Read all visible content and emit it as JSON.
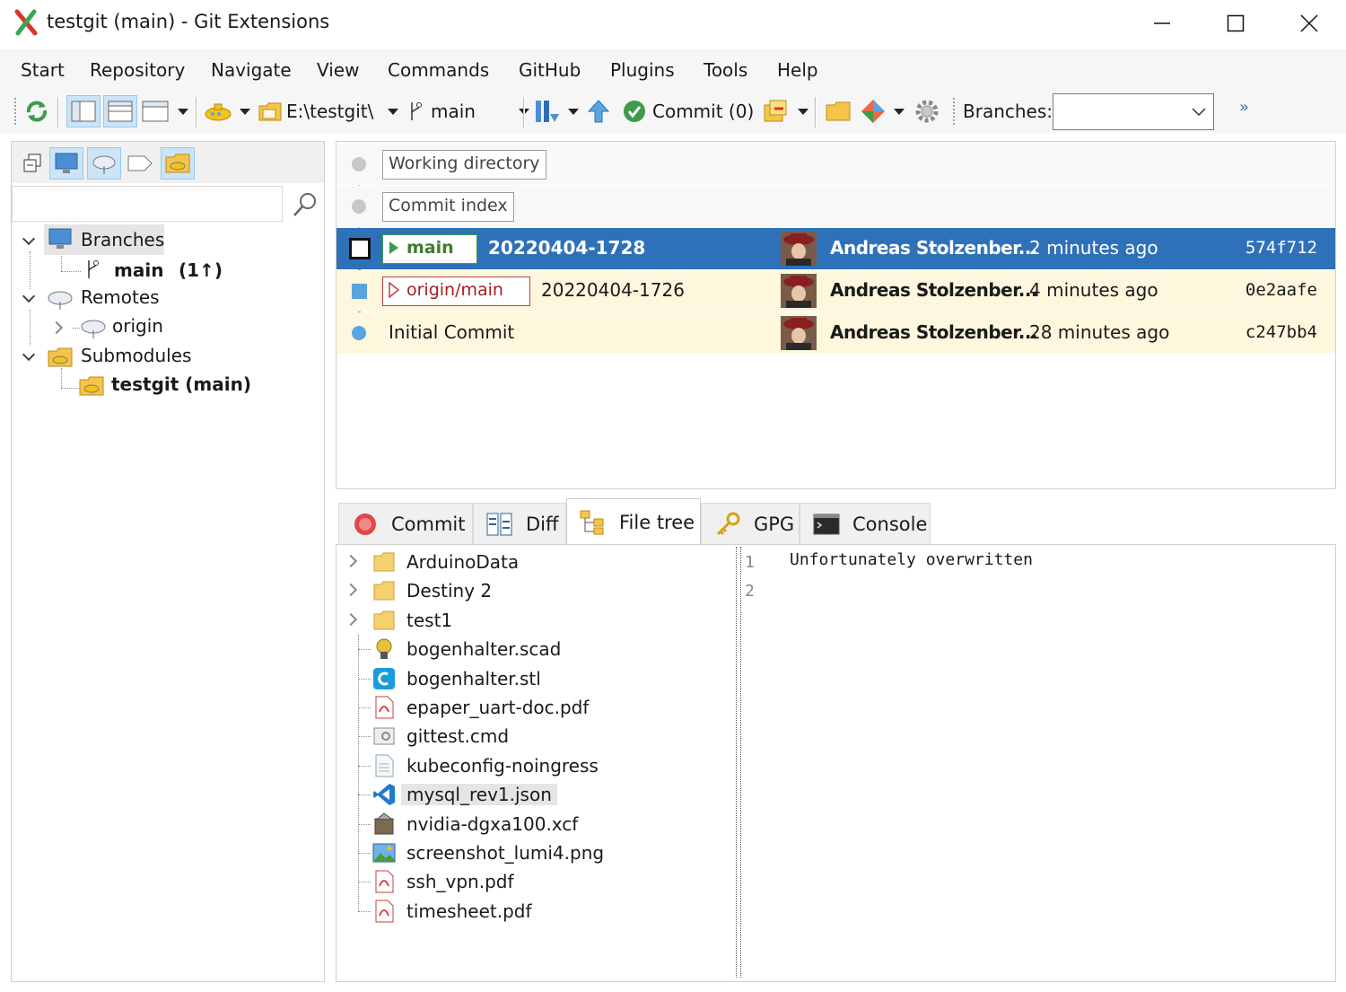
{
  "window": {
    "title": "testgit (main) - Git Extensions"
  },
  "menu": [
    "Start",
    "Repository",
    "Navigate",
    "View",
    "Commands",
    "GitHub",
    "Plugins",
    "Tools",
    "Help"
  ],
  "toolbar": {
    "repo_path": "E:\\testgit\\",
    "branch": "main",
    "commit_label": "Commit (0)",
    "branches_label": "Branches:",
    "branches_value": "",
    "overflow": "»"
  },
  "left_tree": {
    "search_value": "",
    "branches": "Branches",
    "branch_main": "main",
    "branch_main_status": "(1↑)",
    "remotes": "Remotes",
    "remote_origin": "origin",
    "submodules": "Submodules",
    "submodule_testgit": "testgit (main)"
  },
  "grid": {
    "working_directory": "Working directory",
    "commit_index": "Commit index",
    "commits": [
      {
        "ref": "main",
        "message": "20220404-1728",
        "author": "Andreas Stolzenber...",
        "date": "2 minutes ago",
        "hash": "574f712"
      },
      {
        "ref": "origin/main",
        "message": "20220404-1726",
        "author": "Andreas Stolzenber...",
        "date": "4 minutes ago",
        "hash": "0e2aafe"
      },
      {
        "ref": "",
        "message": "Initial Commit",
        "author": "Andreas Stolzenber...",
        "date": "28 minutes ago",
        "hash": "c247bb4"
      }
    ]
  },
  "tabs": [
    "Commit",
    "Diff",
    "File tree",
    "GPG",
    "Console"
  ],
  "file_tree": [
    {
      "name": "ArduinoData",
      "kind": "folder"
    },
    {
      "name": "Destiny 2",
      "kind": "folder"
    },
    {
      "name": "test1",
      "kind": "folder"
    },
    {
      "name": "bogenhalter.scad",
      "kind": "openscad"
    },
    {
      "name": "bogenhalter.stl",
      "kind": "cura"
    },
    {
      "name": "epaper_uart-doc.pdf",
      "kind": "pdf"
    },
    {
      "name": "gittest.cmd",
      "kind": "cmd"
    },
    {
      "name": "kubeconfig-noingress",
      "kind": "text"
    },
    {
      "name": "mysql_rev1.json",
      "kind": "vscode"
    },
    {
      "name": "nvidia-dgxa100.xcf",
      "kind": "gimp"
    },
    {
      "name": "screenshot_lumi4.png",
      "kind": "image"
    },
    {
      "name": "ssh_vpn.pdf",
      "kind": "pdf"
    },
    {
      "name": "timesheet.pdf",
      "kind": "pdf"
    }
  ],
  "viewer": {
    "line_numbers": [
      "1",
      "2"
    ],
    "lines": [
      "Unfortunately overwritten",
      ""
    ]
  },
  "colors": {
    "selection": "#2f71b8",
    "row_highlight": "#fdf7de",
    "graph": "#5aa5e0"
  }
}
